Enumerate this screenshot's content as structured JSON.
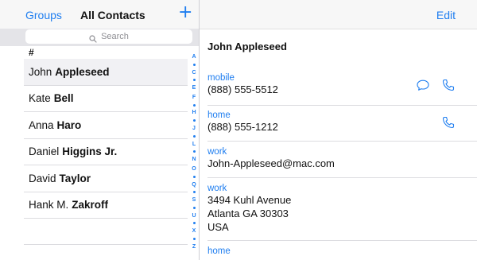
{
  "nav": {
    "groups_label": "Groups",
    "title": "All Contacts",
    "add_label": "+",
    "edit_label": "Edit"
  },
  "search": {
    "placeholder": "Search"
  },
  "list": {
    "section_header": "#",
    "contacts": [
      {
        "first": "John",
        "last": "Appleseed"
      },
      {
        "first": "Kate",
        "last": "Bell"
      },
      {
        "first": "Anna",
        "last": "Haro"
      },
      {
        "first": "Daniel",
        "last": "Higgins Jr."
      },
      {
        "first": "David",
        "last": "Taylor"
      },
      {
        "first": "Hank M.",
        "last": "Zakroff"
      }
    ]
  },
  "index_letters": [
    "A",
    "•",
    "C",
    "•",
    "E",
    "F",
    "•",
    "H",
    "•",
    "J",
    "•",
    "L",
    "•",
    "N",
    "O",
    "•",
    "Q",
    "•",
    "S",
    "•",
    "U",
    "•",
    "X",
    "•",
    "Z"
  ],
  "detail": {
    "name": "John Appleseed",
    "fields": [
      {
        "label": "mobile",
        "lines": [
          "(888) 555-5512"
        ]
      },
      {
        "label": "home",
        "lines": [
          "(888) 555-1212"
        ]
      },
      {
        "label": "work",
        "lines": [
          "John-Appleseed@mac.com"
        ]
      },
      {
        "label": "work",
        "lines": [
          "3494 Kuhl Avenue",
          "Atlanta GA 30303",
          "USA"
        ]
      },
      {
        "label": "home",
        "lines": []
      }
    ]
  },
  "icons": {
    "search": "search-icon",
    "message": "message-icon",
    "phone": "phone-icon"
  },
  "colors": {
    "accent": "#1f7ef0",
    "separator": "#dcdce0",
    "nav_background": "#f7f7f7"
  }
}
